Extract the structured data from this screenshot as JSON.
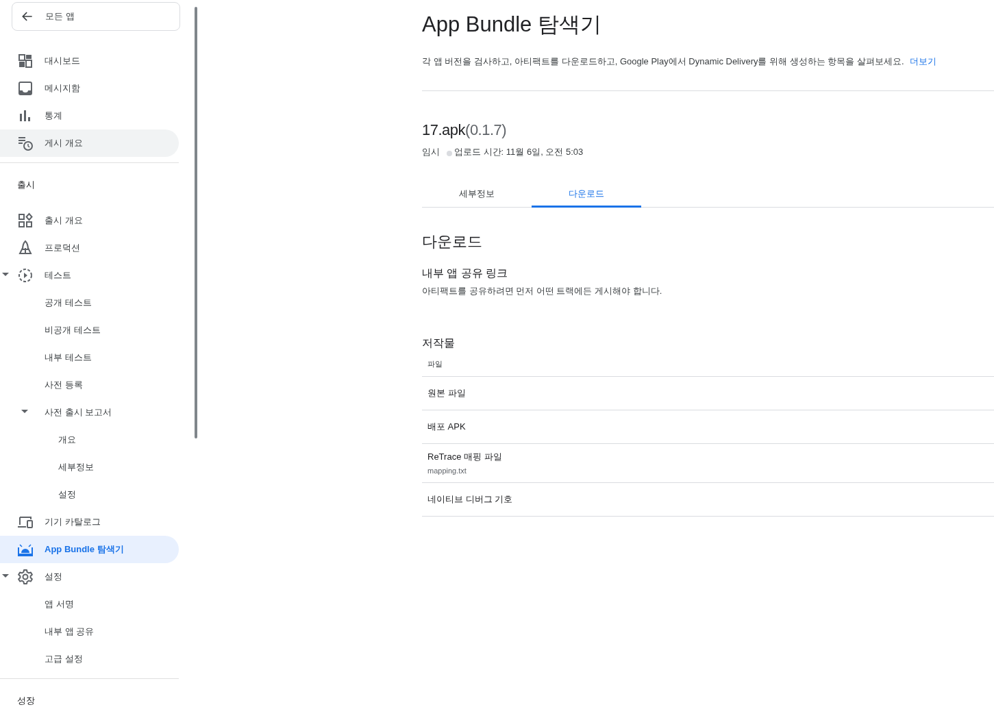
{
  "sidebar": {
    "back_button": {
      "label": "모든 앱"
    },
    "sections": [
      {
        "items": [
          {
            "label": "대시보드",
            "selected": false,
            "hovered": false
          },
          {
            "label": "메시지함",
            "selected": false,
            "hovered": false
          },
          {
            "label": "통계",
            "selected": false,
            "hovered": false
          },
          {
            "label": "게시 개요",
            "selected": false,
            "hovered": true
          }
        ]
      },
      {
        "header": "출시",
        "items": [
          {
            "label": "출시 개요",
            "selected": false,
            "hovered": false
          },
          {
            "label": "프로덕션",
            "selected": false,
            "hovered": false
          },
          {
            "label": "테스트",
            "selected": false,
            "hovered": false,
            "expanded": true,
            "children": [
              {
                "label": "공개 테스트",
                "selected": false,
                "hovered": false
              },
              {
                "label": "비공개 테스트",
                "selected": false,
                "hovered": false
              },
              {
                "label": "내부 테스트",
                "selected": false,
                "hovered": false
              },
              {
                "label": "사전 등록",
                "selected": false,
                "hovered": false
              },
              {
                "label": "사전 출시 보고서",
                "selected": false,
                "hovered": false,
                "expanded": true,
                "children": [
                  {
                    "label": "개요",
                    "selected": false,
                    "hovered": false
                  },
                  {
                    "label": "세부정보",
                    "selected": false,
                    "hovered": false
                  },
                  {
                    "label": "설정",
                    "selected": false,
                    "hovered": false
                  }
                ]
              }
            ]
          },
          {
            "label": "기기 카탈로그",
            "selected": false,
            "hovered": false
          },
          {
            "label": "App Bundle 탐색기",
            "selected": true,
            "hovered": false
          },
          {
            "label": "설정",
            "selected": false,
            "hovered": false,
            "expanded": true,
            "children": [
              {
                "label": "앱 서명",
                "selected": false,
                "hovered": false
              },
              {
                "label": "내부 앱 공유",
                "selected": false,
                "hovered": false
              },
              {
                "label": "고급 설정",
                "selected": false,
                "hovered": false
              }
            ]
          }
        ]
      },
      {
        "header": "성장"
      }
    ]
  },
  "page": {
    "title": "App Bundle 탐색기",
    "description": "각 앱 버전을 검사하고, 아티팩트를 다운로드하고, Google Play에서 Dynamic Delivery를 위해 생성하는 항목을 살펴보세요.",
    "learn_more_link": "더보기",
    "artifact": {
      "name": "17.apk",
      "version": "(0.1.7)",
      "status": "임시",
      "uploaded": "업로드 시간: 11월 6일, 오전 5:03"
    },
    "tabs": [
      {
        "label": "세부정보",
        "selected": false
      },
      {
        "label": "다운로드",
        "selected": true
      }
    ],
    "section_title": "다운로드",
    "share_link": {
      "title": "내부 앱 공유 링크",
      "text": "아티팩트를 공유하려면 먼저 어떤 트랙에든 게시해야 합니다."
    },
    "assets": {
      "title": "저작물",
      "column": "파일",
      "rows": [
        {
          "name": "원본 파일"
        },
        {
          "name": "배포 APK"
        },
        {
          "name": "ReTrace 매핑 파일",
          "file": "mapping.txt"
        },
        {
          "name": "네이티브 디버그 기호"
        }
      ]
    }
  }
}
